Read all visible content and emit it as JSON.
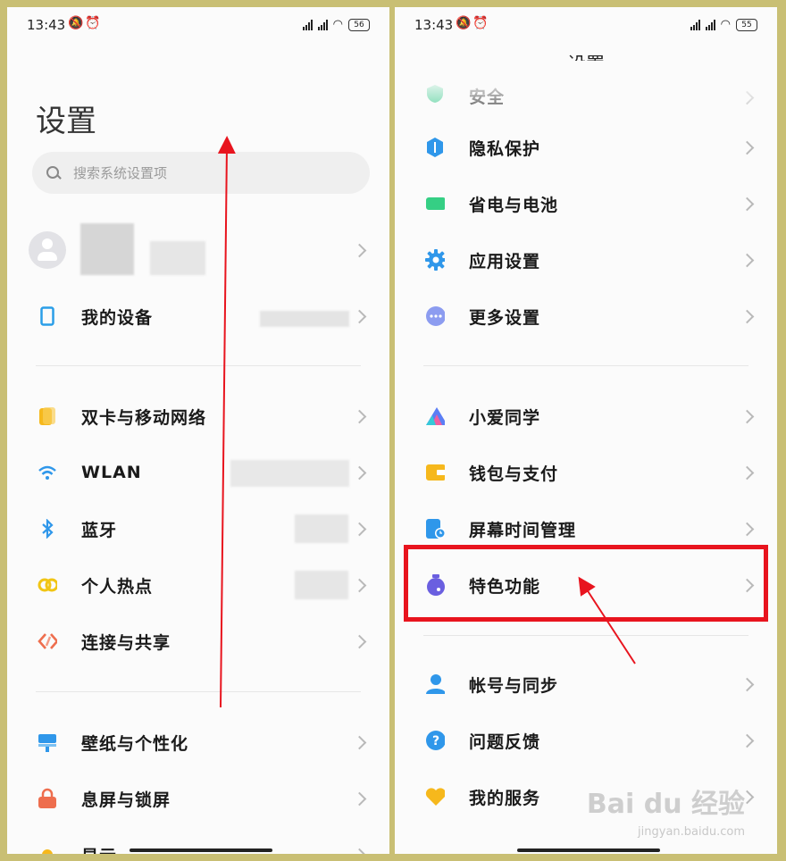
{
  "left": {
    "status_time": "13:43",
    "battery": "56",
    "title": "设置",
    "search_placeholder": "搜索系统设置项",
    "items": [
      {
        "label": "我的设备",
        "icon": "tablet-icon",
        "color": "#2a9ee8"
      },
      {
        "label": "双卡与移动网络",
        "icon": "sim-icon",
        "color": "#f6b81c"
      },
      {
        "label": "WLAN",
        "icon": "wifi-icon",
        "color": "#2f97ea"
      },
      {
        "label": "蓝牙",
        "icon": "bluetooth-icon",
        "color": "#2f97ea"
      },
      {
        "label": "个人热点",
        "icon": "hotspot-icon",
        "color": "#f1c514"
      },
      {
        "label": "连接与共享",
        "icon": "share-icon",
        "color": "#ee6e4e"
      },
      {
        "label": "壁纸与个性化",
        "icon": "wallpaper-icon",
        "color": "#2f97ea"
      },
      {
        "label": "息屏与锁屏",
        "icon": "lock-icon",
        "color": "#ee6e4e"
      },
      {
        "label": "显示",
        "icon": "sun-icon",
        "color": "#f6b81c"
      }
    ]
  },
  "right": {
    "status_time": "13:43",
    "battery": "55",
    "title": "设置",
    "items": [
      {
        "label": "安全",
        "icon": "shield-icon",
        "color": "#35c98a"
      },
      {
        "label": "隐私保护",
        "icon": "privacy-icon",
        "color": "#2f97ea"
      },
      {
        "label": "省电与电池",
        "icon": "battery-icon",
        "color": "#35cf84"
      },
      {
        "label": "应用设置",
        "icon": "gear-icon",
        "color": "#2f97ea"
      },
      {
        "label": "更多设置",
        "icon": "more-icon",
        "color": "#8c9cf0"
      },
      {
        "label": "小爱同学",
        "icon": "xiaoai-icon",
        "color": "#5b7ef5"
      },
      {
        "label": "钱包与支付",
        "icon": "wallet-icon",
        "color": "#f6b81c"
      },
      {
        "label": "屏幕时间管理",
        "icon": "screen-time-icon",
        "color": "#2f97ea"
      },
      {
        "label": "特色功能",
        "icon": "flask-icon",
        "color": "#6a5fe0"
      },
      {
        "label": "帐号与同步",
        "icon": "account-icon",
        "color": "#2f97ea"
      },
      {
        "label": "问题反馈",
        "icon": "feedback-icon",
        "color": "#2f97ea"
      },
      {
        "label": "我的服务",
        "icon": "heart-icon",
        "color": "#f6b81c"
      }
    ]
  },
  "watermark": {
    "main": "Bai du 经验",
    "sub": "jingyan.baidu.com"
  },
  "colors": {
    "annotation": "#e8141e",
    "frame": "#c9bf74"
  }
}
